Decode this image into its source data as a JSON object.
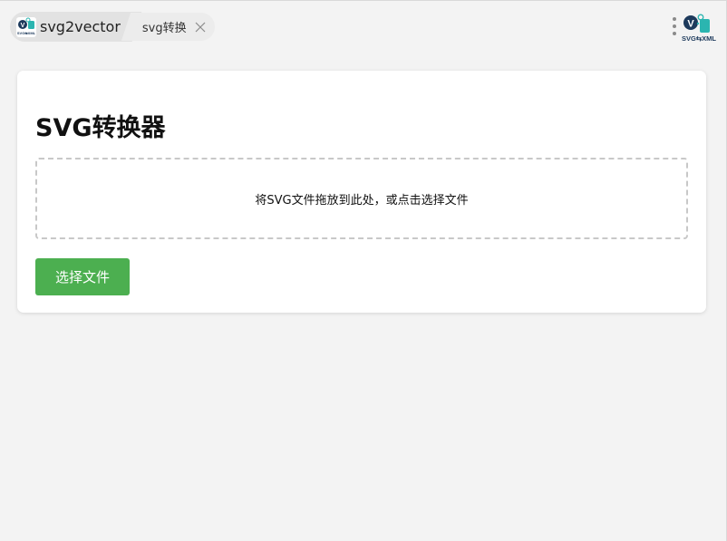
{
  "tabs": {
    "main_label": "svg2vector",
    "main_icon": "svg2vector-logo-icon",
    "sub_label": "svg转换",
    "close_icon": "close-icon"
  },
  "header": {
    "menu_icon": "more-vertical-icon",
    "logo_text": "SVG⇆XML",
    "logo_letter": "V"
  },
  "main": {
    "title": "SVG转换器",
    "drop_text": "将SVG文件拖放到此处，或点击选择文件",
    "select_button_label": "选择文件"
  },
  "colors": {
    "accent": "#4caf50",
    "logo_dark": "#1d3a5c",
    "logo_teal": "#2bb5b0",
    "background": "#f3f3f3"
  }
}
